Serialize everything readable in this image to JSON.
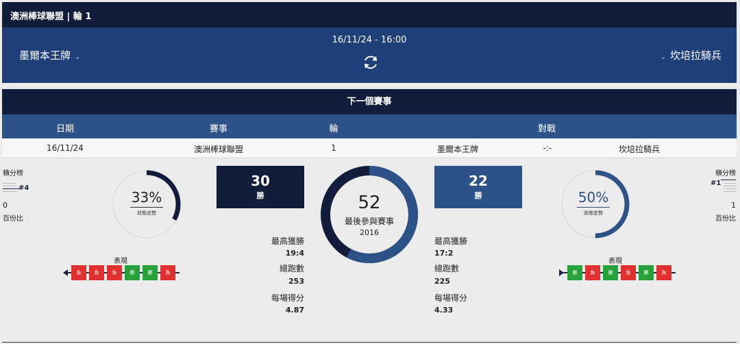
{
  "header": {
    "title": "澳洲棒球聯盟 | 輪 1"
  },
  "match": {
    "home_team": "墨爾本王牌",
    "away_team": "坎培拉騎兵",
    "datetime": "16/11/24 - 16:00",
    "home_chevron": "⌄",
    "away_chevron": "⌄"
  },
  "next_event": {
    "title": "下一個賽事",
    "columns": [
      "日期",
      "賽事",
      "輪",
      "對戰"
    ],
    "row": {
      "date": "16/11/24",
      "competition": "澳洲棒球聯盟",
      "round": "1",
      "home": "墨爾本王牌",
      "score": "-:-",
      "away": "坎培拉騎兵"
    }
  },
  "left_side": {
    "standings_label": "積分榜",
    "rank": "#4",
    "value": "0",
    "pct_label": "百份比"
  },
  "right_side": {
    "standings_label": "積分榜",
    "rank": "#1",
    "value": "1",
    "pct_label": "百份比"
  },
  "home_form": {
    "pct": "33%",
    "fraction": 0.33,
    "sub": "狀態走勢",
    "form_title": "表現",
    "results": [
      "負",
      "負",
      "負",
      "勝",
      "勝",
      "負"
    ]
  },
  "away_form": {
    "pct": "50%",
    "fraction": 0.5,
    "sub": "狀態走勢",
    "form_title": "表現",
    "results": [
      "勝",
      "負",
      "勝",
      "負",
      "勝",
      "負"
    ]
  },
  "home_wins": {
    "value": "30",
    "label": "勝"
  },
  "away_wins": {
    "value": "22",
    "label": "勝"
  },
  "center": {
    "total": "52",
    "label": "最後參與賽事",
    "year": "2016",
    "home_share": 0.577
  },
  "home_stats": {
    "max_win_label": "最高獲勝",
    "max_win": "19:4",
    "total_runs_label": "總跑數",
    "total_runs": "253",
    "avg_label": "每場得分",
    "avg": "4.87"
  },
  "away_stats": {
    "max_win_label": "最高獲勝",
    "max_win": "17:2",
    "total_runs_label": "總跑數",
    "total_runs": "225",
    "avg_label": "每場得分",
    "avg": "4.33"
  },
  "colors": {
    "navy": "#121d3c",
    "blue": "#1f3f7a",
    "mid_blue": "#2d5288",
    "win": "#27a13a",
    "loss": "#e03030"
  }
}
